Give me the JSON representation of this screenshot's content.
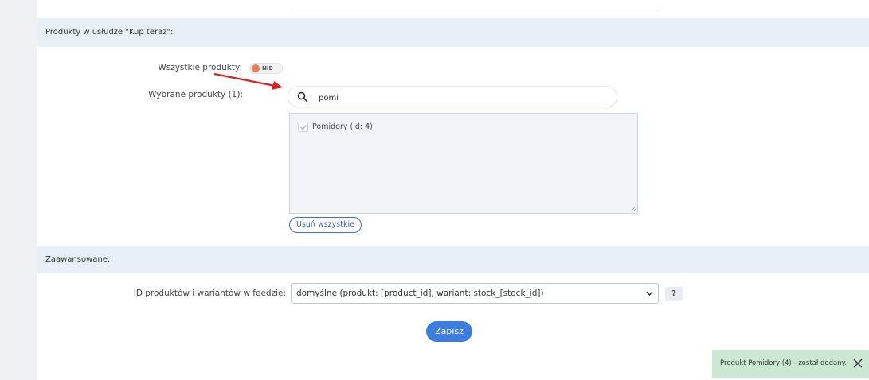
{
  "section_products": {
    "title": "Produkty w usłudze \"Kup teraz\":",
    "all_products_label": "Wszystkie produkty:",
    "all_products_toggle": "NIE",
    "selected_products_label": "Wybrane produkty (1):",
    "search": {
      "value": "pomi",
      "placeholder": ""
    },
    "list_items": [
      {
        "label": "Pomidory (id: 4)",
        "checked": true
      }
    ],
    "remove_all_button": "Usuń wszystkie"
  },
  "section_advanced": {
    "title": "Zaawansowane:",
    "feed_id_label": "ID produktów i wariantów w feedzie:",
    "feed_id_select": "domyślne (produkt: [product_id], wariant: stock_[stock_id])",
    "help_button": "?"
  },
  "save_button": "Zapisz",
  "toast": {
    "message": "Produkt Pomidory (4) - został dodany."
  },
  "colors": {
    "accent": "#3b7de0",
    "toggle_off": "#f47a54",
    "section_header_bg": "#e8eff7",
    "toast_bg": "#cbe8d4",
    "arrow": "#e02020"
  },
  "icons": {
    "search": "search-icon",
    "check": "check-icon",
    "chevron": "chevron-down-icon",
    "close": "close-icon",
    "arrow": "red-arrow-annotation"
  }
}
